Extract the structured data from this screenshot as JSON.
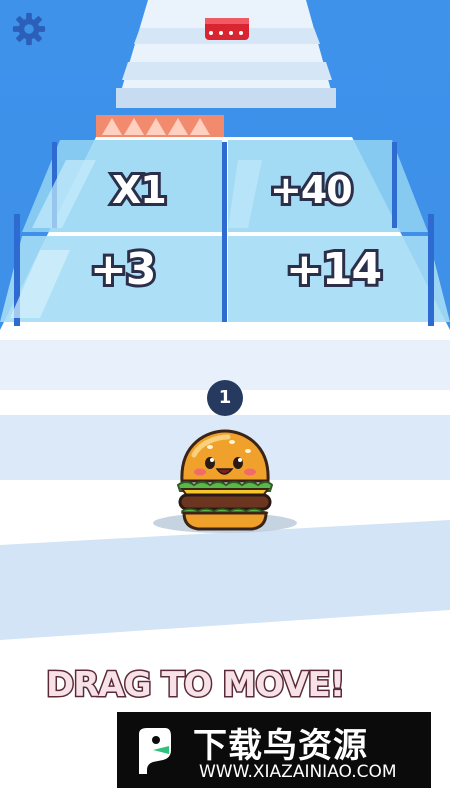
{
  "game": {
    "gates": {
      "far_left": "X1",
      "far_right": "+40",
      "near_left": "+3",
      "near_right": "+14"
    },
    "player_count": "1",
    "hint": "DRAG TO MOVE!"
  },
  "watermark": {
    "title": "下载鸟资源",
    "url": "WWW.XIAZAINIAO.COM"
  },
  "icons": {
    "settings": "gear-icon",
    "player": "burger-character-icon",
    "watermark_logo": "bird-logo-icon"
  },
  "colors": {
    "sky": "#3d8fe6",
    "road": "#ffffff",
    "road_stripe": "#dbeaf8",
    "gate_panel": "#8fd0f3",
    "spike_strip": "#f47a6c",
    "label_outline": "#2b2f4a",
    "hint_text": "#f7e2e8"
  }
}
